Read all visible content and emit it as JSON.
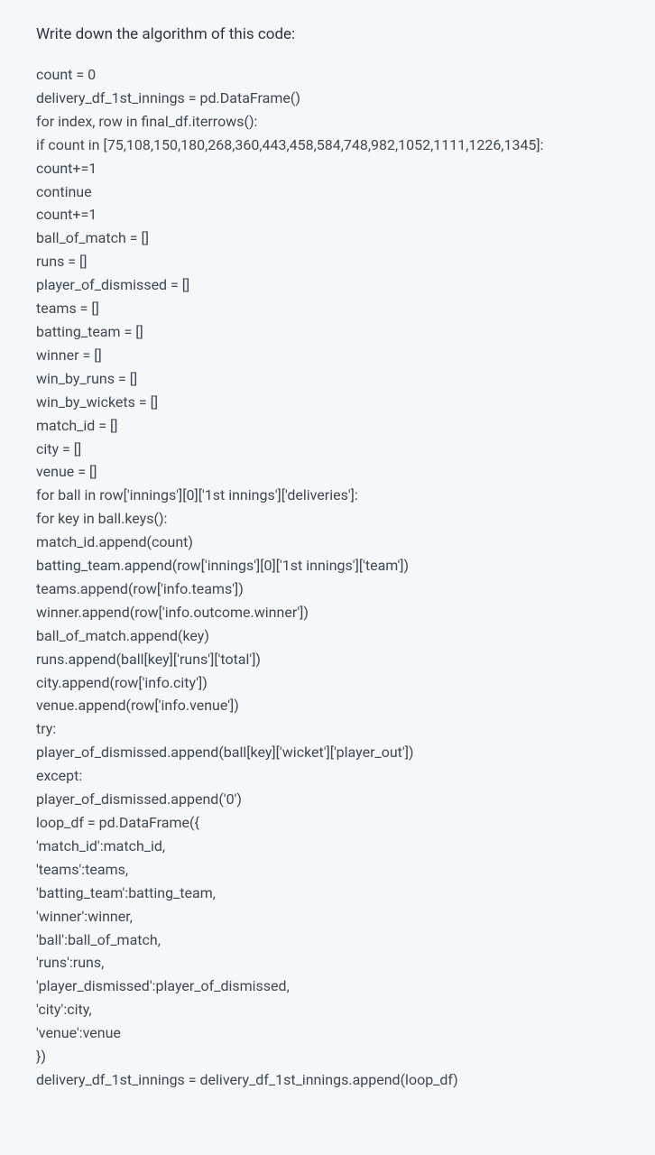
{
  "heading": "Write down the algorithm of this code:",
  "code": {
    "lines": [
      "count = 0",
      "delivery_df_1st_innings = pd.DataFrame()",
      "for index, row in final_df.iterrows():",
      "if count in [75,108,150,180,268,360,443,458,584,748,982,1052,1111,1226,1345]:",
      "count+=1",
      "continue",
      "count+=1",
      "ball_of_match = []",
      "runs = []",
      "player_of_dismissed = []",
      "teams = []",
      "batting_team = []",
      "winner = []",
      "win_by_runs = []",
      "win_by_wickets = []",
      "match_id = []",
      "city = []",
      "venue = []",
      "for ball in row['innings'][0]['1st innings']['deliveries']:",
      "for key in ball.keys():",
      "match_id.append(count)",
      "batting_team.append(row['innings'][0]['1st innings']['team'])",
      "teams.append(row['info.teams'])",
      "winner.append(row['info.outcome.winner'])",
      "ball_of_match.append(key)",
      "runs.append(ball[key]['runs']['total'])",
      "city.append(row['info.city'])",
      "venue.append(row['info.venue'])",
      "try:",
      "player_of_dismissed.append(ball[key]['wicket']['player_out'])",
      "except:",
      "player_of_dismissed.append('0')",
      "loop_df = pd.DataFrame({",
      "'match_id':match_id,",
      "'teams':teams,",
      "'batting_team':batting_team,",
      "'winner':winner,",
      "'ball':ball_of_match,",
      "'runs':runs,",
      "'player_dismissed':player_of_dismissed,",
      "'city':city,",
      "'venue':venue",
      "})",
      "delivery_df_1st_innings = delivery_df_1st_innings.append(loop_df)"
    ]
  }
}
